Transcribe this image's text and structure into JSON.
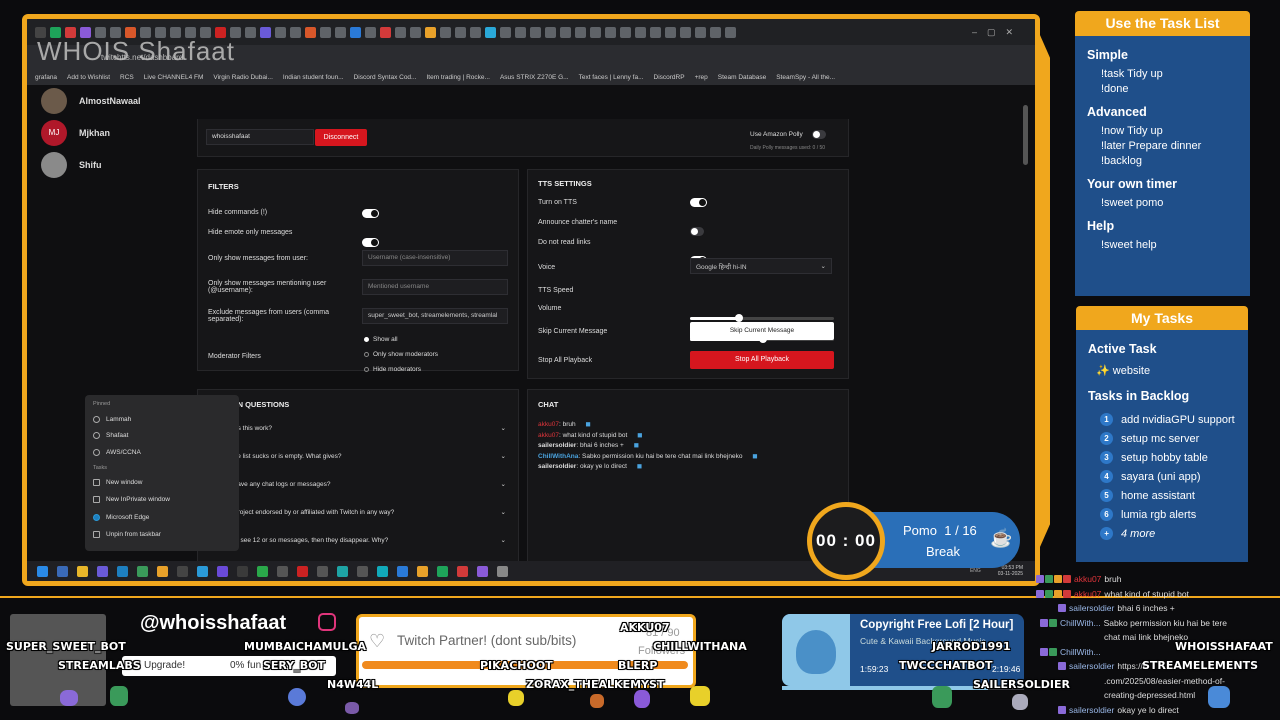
{
  "browser": {
    "overlay_title": "WHOIS Shafaat",
    "url": "twitchtts.net/dashboard",
    "bookmarks": [
      "grafana",
      "Add to Wishlist",
      "RCS",
      "Live CHANNEL4 FM",
      "Virgin Radio Dubai...",
      "Indian student foun...",
      "Discord Syntax Cod...",
      "Item trading | Rocke...",
      "Asus STRIX Z270E G...",
      "Text faces | Lenny fa...",
      "DiscordRP",
      "+rep",
      "Steam Database",
      "SteamSpy - All the..."
    ]
  },
  "users": [
    {
      "name": "AlmostNawaal",
      "color": "#6b5a4a"
    },
    {
      "name": "Mjkhan",
      "color": "#b0182a",
      "initials": "MJ"
    },
    {
      "name": "Shifu",
      "color": "#8a8a8a"
    }
  ],
  "account": {
    "username": "whoisshafaat",
    "disconnect_label": "Disconnect",
    "polly_label": "Use Amazon Polly",
    "polly_usage": "Daily Polly messages used: 0 / 50"
  },
  "filters": {
    "title": "FILTERS",
    "hide_commands": "Hide commands (!)",
    "hide_emote": "Hide emote only messages",
    "only_from_user": "Only show messages from user:",
    "only_from_user_placeholder": "Username (case-insensitive)",
    "mentioning": "Only show messages mentioning user (@username):",
    "mentioning_placeholder": "Mentioned username",
    "exclude": "Exclude messages from users (comma separated):",
    "exclude_value": "super_sweet_bot, streamelements, streamlal",
    "moderator_filters": "Moderator Filters",
    "radio_options": [
      "Show all",
      "Only show moderators",
      "Hide moderators"
    ]
  },
  "tts": {
    "title": "TTS SETTINGS",
    "turn_on": "Turn on TTS",
    "announce": "Announce chatter's name",
    "no_links": "Do not read links",
    "voice_label": "Voice",
    "voice_value": "Google हिन्दी hi-IN",
    "speed_label": "TTS Speed",
    "speed_level": 0.34,
    "volume_label": "Volume",
    "volume_level": 0.51,
    "skip_label": "Skip Current Message",
    "skip_button": "Skip Current Message",
    "stop_label": "Stop All Playback",
    "stop_button": "Stop All Playback"
  },
  "faq": {
    "title": "COMMON QUESTIONS",
    "items": [
      "How does this work?",
      "The voice list sucks or is empty. What gives?",
      "Do you save any chat logs or messages?",
      "Is this project endorsed by or affiliated with Twitch in any way?",
      "I only see 12 or so messages, then they disappear. Why?"
    ],
    "items_visible": [
      "es this work?",
      "ce list sucks or is empty. What gives?",
      "save any chat logs or messages?",
      "project endorsed by or affiliated with Twitch in any way?",
      "ly see 12 or so messages, then they disappear. Why?"
    ]
  },
  "chat": {
    "title": "CHAT",
    "lines": [
      {
        "user": "akku07",
        "color": "#e0353b",
        "text": "bruh"
      },
      {
        "user": "akku07",
        "color": "#e0353b",
        "text": "what kind of stupid bot"
      },
      {
        "user": "sailersoldier",
        "color": "#dddddd",
        "text": "bhai 6 inches +"
      },
      {
        "user": "ChillWithAna",
        "color": "#4aa3df",
        "text": "Sabko permission kiu hai be tere chat mai link bhejneko"
      },
      {
        "user": "sailersoldier",
        "color": "#dddddd",
        "text": "okay ye lo direct"
      }
    ]
  },
  "context_menu": {
    "pinned_header": "Pinned",
    "pinned": [
      "Lammah",
      "Shafaat",
      "AWS/CCNA"
    ],
    "tasks_header": "Tasks",
    "tasks": [
      "New window",
      "New InPrivate window"
    ],
    "app": "Microsoft Edge",
    "unpin": "Unpin from taskbar"
  },
  "taskbar": {
    "clock": "03:53 PM",
    "date": "03-11-2025",
    "lang": "ENG"
  },
  "task_list": {
    "title": "Use the Task List",
    "sections": [
      {
        "heading": "Simple",
        "cmds": [
          "!task Tidy up",
          "!done"
        ]
      },
      {
        "heading": "Advanced",
        "cmds": [
          "!now Tidy up",
          "!later Prepare dinner",
          "!backlog"
        ]
      },
      {
        "heading": "Your own timer",
        "cmds": [
          "!sweet pomo"
        ]
      },
      {
        "heading": "Help",
        "cmds": [
          "!sweet help"
        ]
      }
    ]
  },
  "my_tasks": {
    "title": "My Tasks",
    "active_heading": "Active Task",
    "active": "website",
    "active_icon": "✨",
    "backlog_heading": "Tasks in Backlog",
    "backlog": [
      "add nvidiaGPU support",
      "setup mc server",
      "setup hobby table",
      "sayara (uni app)",
      "home assistant",
      "lumia rgb alerts"
    ],
    "more": "4 more"
  },
  "pomodoro": {
    "time": "00 : 00",
    "label": "Pomo",
    "count": "1",
    "sep": "/",
    "total": "16",
    "state": "Break"
  },
  "stream": {
    "handle": "@whoisshafaat",
    "partner": "Twitch Partner! (dont sub/bits)",
    "followers_count": "81 / 90",
    "followers_label": "Followers",
    "upgrade": "Upgrade!",
    "fund": "0% fun",
    "music_title": "Copyright Free Lofi [2 Hour]",
    "music_sub": "Cute & Kawaii Background Music",
    "music_elapsed": "1:59:23",
    "music_total": "2:19:46",
    "music_progress": 0.85,
    "viewer_names": [
      "SUPER_SWEET_BOT",
      "STREAMLABS",
      "MUMBAICHAMULGA",
      "SERY_BOT",
      "N4W44L",
      "AKKU07",
      "CHILLWITHANA",
      "PIKACHOOT",
      "BLERP",
      "ZORAX_THEALKEMYST",
      "TWCCCHATBOT",
      "JARROD1991",
      "WHOISSHAFAAT",
      "STREAMELEMENTS",
      "SAILERSOLDIER"
    ]
  },
  "stream_chat": [
    {
      "user": "akku07",
      "color": "#e0353b",
      "text": "bruh"
    },
    {
      "user": "akku07",
      "color": "#e0353b",
      "text": "what kind of stupid bot"
    },
    {
      "user": "sailersoldier",
      "color": "#9ab8e8",
      "text": "bhai 6 inches +"
    },
    {
      "user": "ChillWith...",
      "color": "#9ab8e8",
      "text": "Sabko permission kiu hai be tere"
    },
    {
      "user": "",
      "color": "#9ab8e8",
      "text": "chat mai link bhejneko"
    },
    {
      "user": "ChillWith...",
      "color": "#9ab8e8",
      "text": ""
    },
    {
      "user": "sailersoldier",
      "color": "#9ab8e8",
      "text": "https://r"
    },
    {
      "user": "",
      "color": "#9ab8e8",
      "text": ".com/2025/08/easier-method-of-"
    },
    {
      "user": "",
      "color": "#9ab8e8",
      "text": "creating-depressed.html"
    },
    {
      "user": "sailersoldier",
      "color": "#9ab8e8",
      "text": "okay ye lo direct"
    }
  ],
  "colors": {
    "accent": "#f0a71d",
    "panel_blue": "#1f4f8a",
    "danger": "#d6161e"
  }
}
